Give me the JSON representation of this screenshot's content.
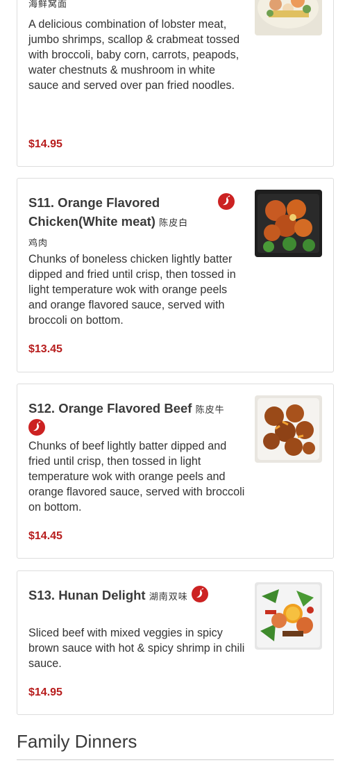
{
  "items": [
    {
      "title_cjk": "海鲜窝面",
      "description": "A delicious combination of lobster meat, jumbo shrimps, scallop & crabmeat tossed with broccoli, baby corn, carrots, peapods, water chestnuts & mushroom in white sauce and served over pan fried noodles.",
      "price": "$14.95",
      "image": "seafood-noodles-photo"
    },
    {
      "title": "S11. Orange Flavored Chicken(White meat)",
      "title_cjk": "陈皮白鸡肉",
      "spicy": true,
      "description": "Chunks of boneless chicken lightly batter dipped and fried until crisp, then tossed in light temperature wok with orange peels and orange flavored sauce, served with broccoli on bottom.",
      "price": "$13.45",
      "image": "orange-chicken-photo"
    },
    {
      "title": "S12. Orange Flavored Beef",
      "title_cjk": "陈皮牛",
      "spicy": true,
      "description": "Chunks of beef lightly batter dipped and fried until crisp, then tossed in light temperature wok with orange peels and orange flavored sauce, served with broccoli on bottom.",
      "price": "$14.45",
      "image": "orange-beef-photo"
    },
    {
      "title": "S13. Hunan Delight",
      "title_cjk": "湖南双味",
      "spicy": true,
      "description": "Sliced beef with mixed veggies in spicy brown sauce with hot & spicy shrimp in chili sauce.",
      "price": "$14.95",
      "image": "hunan-delight-photo"
    }
  ],
  "section": {
    "title": "Family Dinners"
  },
  "colors": {
    "price": "#b71c1c",
    "spicy_badge": "#cc2222",
    "border": "#dddddd"
  }
}
